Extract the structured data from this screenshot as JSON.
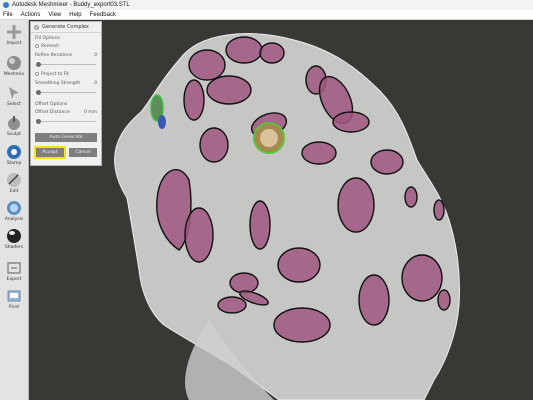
{
  "window": {
    "title": "Autodesk Meshmixer - Buddy_export03.STL"
  },
  "menu": [
    "File",
    "Actions",
    "View",
    "Help",
    "Feedback"
  ],
  "toolbar": {
    "items": [
      {
        "label": "Import",
        "icon": "plus-icon"
      },
      {
        "label": "Meshmix",
        "icon": "meshmix-icon"
      },
      {
        "label": "Select",
        "icon": "select-arrow-icon"
      },
      {
        "label": "Sculpt",
        "icon": "sculpt-brush-icon"
      },
      {
        "label": "Stamp",
        "icon": "stamp-icon"
      },
      {
        "label": "Edit",
        "icon": "edit-icon"
      },
      {
        "label": "Analysis",
        "icon": "analysis-icon"
      },
      {
        "label": "Shaders",
        "icon": "shaders-icon"
      },
      {
        "label": "Export",
        "icon": "export-icon"
      },
      {
        "label": "Print",
        "icon": "print-icon"
      }
    ]
  },
  "panel": {
    "title": "Generate Complex",
    "fill_options": "Fill Options",
    "remesh": "Remesh",
    "refine_iterations": "Refine Iterations",
    "refine_value": "0",
    "project_to_fit": "Project to Fit",
    "smoothing_strength": "Smoothing Strength",
    "smoothing_value": "0",
    "offset_options": "Offset Options",
    "offset_distance": "Offset Distance",
    "offset_value": "0",
    "offset_unit": "mm",
    "auto_generate": "Auto Generate",
    "accept": "Accept",
    "cancel": "Cancel"
  },
  "colors": {
    "viewport_bg": "#3a3835",
    "mesh": "#d9d9d9",
    "patch_fill": "#a0577f",
    "patch_stroke": "#111111",
    "highlight": "#f5e11b"
  }
}
